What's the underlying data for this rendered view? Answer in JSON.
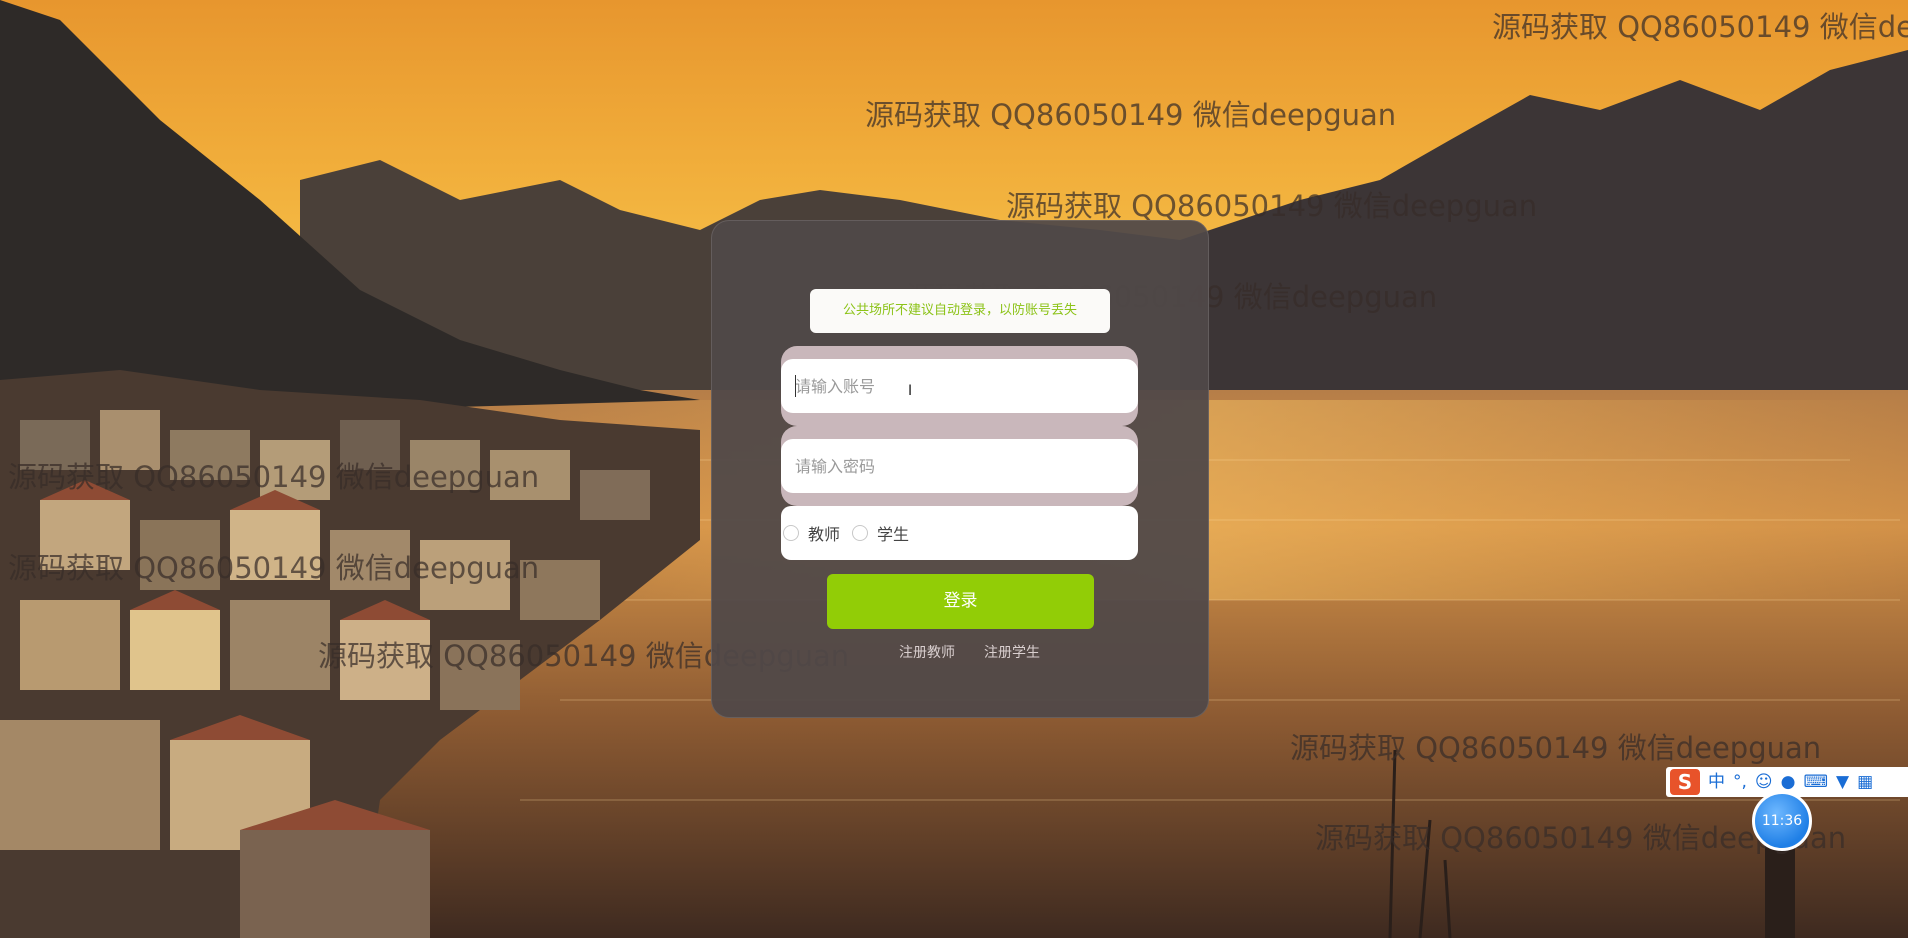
{
  "login": {
    "notice": "公共场所不建议自动登录，以防账号丢失",
    "username_placeholder": "请输入账号",
    "password_placeholder": "请输入密码",
    "roles": [
      "教师",
      "学生"
    ],
    "login_label": "登录",
    "register_teacher": "注册教师",
    "register_student": "注册学生"
  },
  "watermark": "源码获取 QQ86050149 微信deepguan",
  "ime": {
    "logo": "S",
    "mode": "中",
    "punct": "°,",
    "emoji_icon": "smile-icon",
    "voice_icon": "mic-icon",
    "keyboard_icon": "keyboard-icon",
    "skin_icon": "shirt-icon",
    "menu_icon": "grid-icon"
  },
  "clock": "11:36",
  "colors": {
    "accent": "#92cd06",
    "notice_text": "#8cc318",
    "panel": "#504848"
  }
}
